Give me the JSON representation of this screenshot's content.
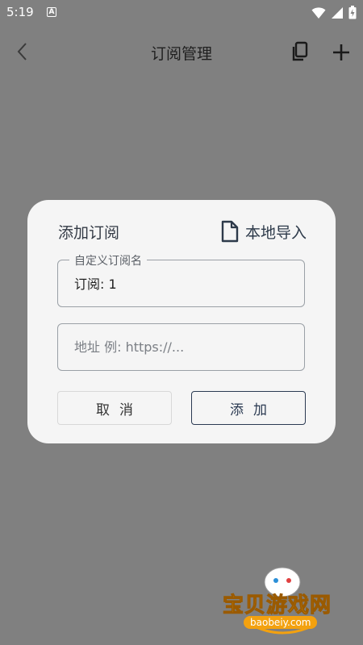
{
  "status_bar": {
    "time": "5:19",
    "a_label": "A"
  },
  "app_bar": {
    "title": "订阅管理"
  },
  "dialog": {
    "title": "添加订阅",
    "import_label": "本地导入",
    "name_field": {
      "label": "自定义订阅名",
      "value": "订阅: 1"
    },
    "url_field": {
      "placeholder": "地址 例: https://..."
    },
    "cancel_label": "取消",
    "add_label": "添加"
  },
  "watermark": {
    "text": "宝贝游戏网",
    "url": "baobeiy.com"
  },
  "colors": {
    "overlay": "#808080",
    "dialog_bg": "#f5f5f5",
    "accent": "#2b3a52"
  }
}
